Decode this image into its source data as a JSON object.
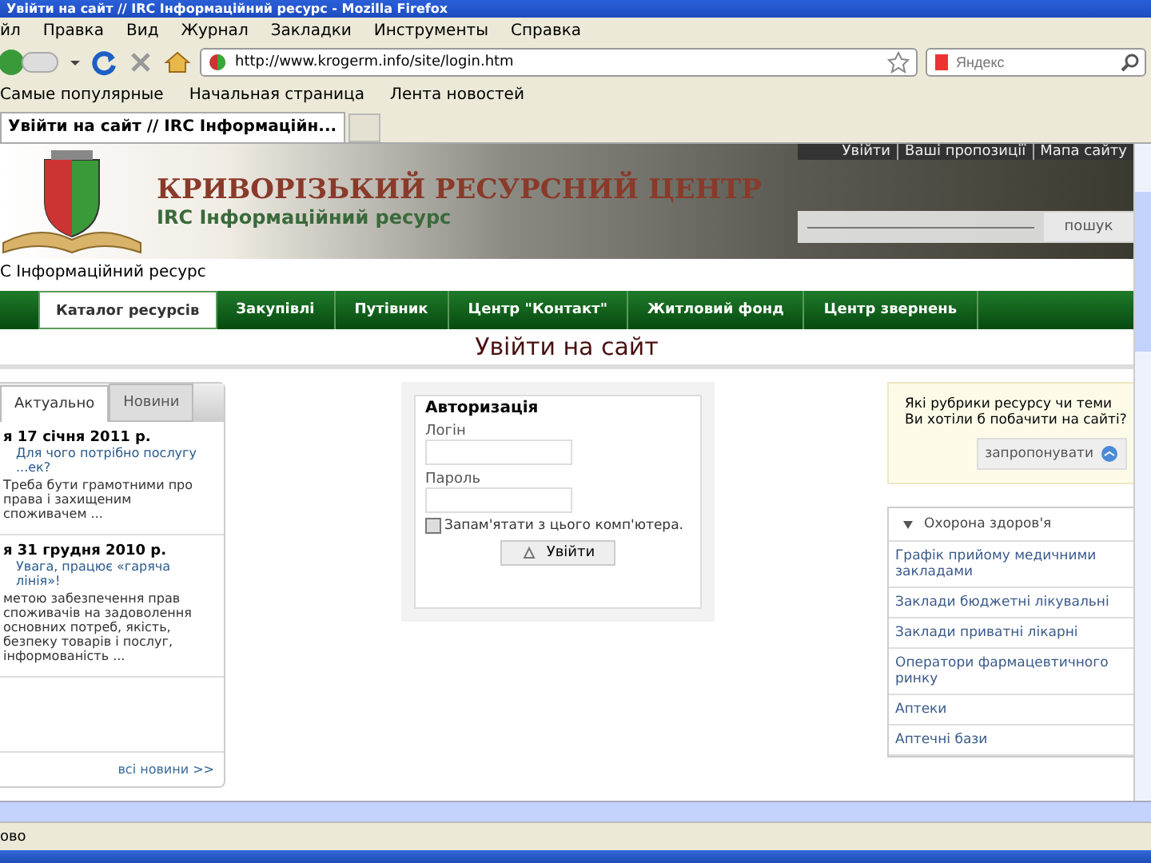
{
  "window": {
    "title": "Увійти на сайт // IRC Інформаційний ресурс - Mozilla Firefox"
  },
  "menu": [
    "йл",
    "Правка",
    "Вид",
    "Журнал",
    "Закладки",
    "Инструменты",
    "Справка"
  ],
  "address": {
    "url": "http://www.krogerm.info/site/login.htm"
  },
  "search": {
    "placeholder": "Яндекс"
  },
  "bookmarks": [
    "Самые популярные",
    "Начальная страница",
    "Лента новостей"
  ],
  "tabs": [
    {
      "label": "Увійти на сайт // IRC Інформаційн...",
      "selected": true
    }
  ],
  "page": {
    "top_links": [
      "Увійти",
      "Ваші пропозиції",
      "Мапа сайту"
    ],
    "site_title": "КРИВОРІЗЬКИЙ РЕСУРСНИЙ ЦЕНТР",
    "site_subtitle": "IRC Інформаційний ресурс",
    "search_button": "пошук",
    "breadcrumb": "C Інформаційний ресурс",
    "nav": [
      {
        "label": "Каталог ресурсів",
        "selected": true
      },
      {
        "label": "Закупівлі",
        "selected": false
      },
      {
        "label": "Путівник",
        "selected": false
      },
      {
        "label": "Центр \"Контакт\"",
        "selected": false
      },
      {
        "label": "Житловий фонд",
        "selected": false
      },
      {
        "label": "Центр звернень",
        "selected": false
      }
    ],
    "heading": "Увійти на сайт",
    "news": {
      "tabs": [
        {
          "label": "Актуально",
          "selected": true
        },
        {
          "label": "Новини",
          "selected": false
        }
      ],
      "items": [
        {
          "date": "я 17 січня 2011 р.",
          "link": "Для чого потрібно послугу ...ек?",
          "text": "Треба бути грамотними про права і захищеним споживачем ..."
        },
        {
          "date": "я 31 грудня 2010 р.",
          "link": "Увага, працює «гаряча лінія»!",
          "text": "метою забезпечення прав споживачів на задоволення основних потреб, якість, безпеку товарів і послуг, інформованість ..."
        }
      ],
      "more": "всі новини >>"
    },
    "login": {
      "title": "Авторизація",
      "username_label": "Логін",
      "password_label": "Пароль",
      "remember": {
        "label": "Запам'ятати з цього комп'ютера.",
        "checked": false
      },
      "button": "Увійти"
    },
    "suggest": {
      "text": "Які рубрики ресурсу чи теми Ви хотіли б побачити на сайті?",
      "button": "запропонувати"
    },
    "categories": {
      "title": "Охорона здоров'я",
      "expanded": true,
      "items": [
        "Графік прийому медичними закладами",
        "Заклади бюджетні лікувальні",
        "Заклади приватні лікарні",
        "Оператори фармацевтичного ринку",
        "Аптеки",
        "Аптечні бази"
      ]
    }
  },
  "status_bar": "ово"
}
